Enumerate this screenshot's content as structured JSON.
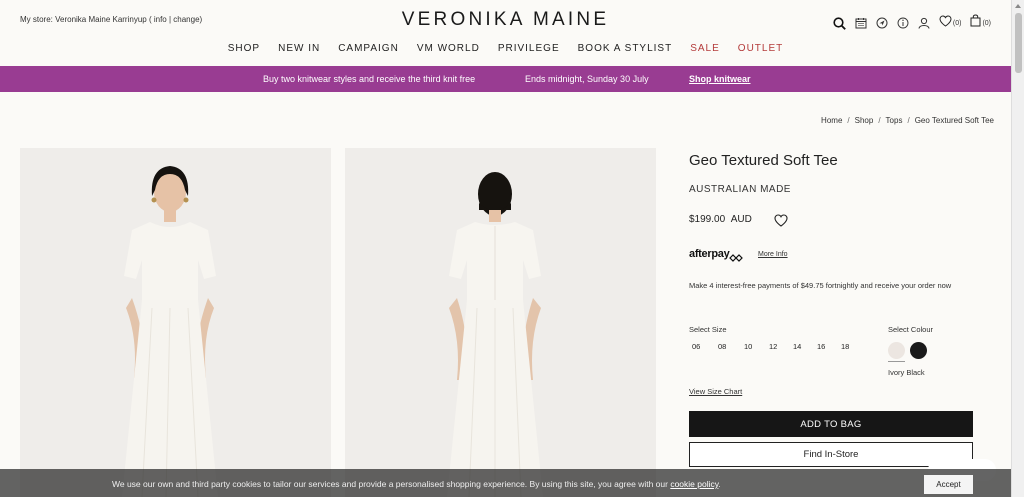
{
  "header": {
    "store_prefix": "My store: Veronika Maine Karrinyup ( ",
    "store_info": "info",
    "store_sep": " | ",
    "store_change": "change",
    "store_suffix": ")",
    "logo": "VERONIKA MAINE",
    "wishlist_count": "(0)",
    "bag_count": "(0)",
    "icons": [
      "search-icon",
      "calendar-icon",
      "location-icon",
      "info-icon",
      "account-icon",
      "heart-icon",
      "bag-icon"
    ]
  },
  "nav": {
    "items": [
      "SHOP",
      "NEW IN",
      "CAMPAIGN",
      "VM WORLD",
      "PRIVILEGE",
      "BOOK A STYLIST",
      "SALE",
      "OUTLET"
    ]
  },
  "promo": {
    "background": "#993c92",
    "text1": "Buy two knitwear styles and receive the third knit free",
    "text2": "Ends midnight, Sunday 30 July",
    "link": "Shop knitwear"
  },
  "breadcrumb": {
    "items": [
      "Home",
      "Shop",
      "Tops",
      "Geo Textured Soft Tee"
    ],
    "separator": "/"
  },
  "product": {
    "title": "Geo Textured Soft Tee",
    "origin": "AUSTRALIAN MADE",
    "price": "$199.00",
    "currency": "AUD",
    "afterpay_logo": "afterpay",
    "more_info": "More Info",
    "instalment": "Make 4 interest-free payments of $49.75 fortnightly and receive your order now",
    "size_label": "Select Size",
    "sizes": [
      "06",
      "08",
      "10",
      "12",
      "14",
      "16",
      "18"
    ],
    "colour_label": "Select Colour",
    "colour_names": "Ivory Black",
    "colours": [
      "#ece6e1",
      "#1a1a1a"
    ],
    "size_chart": "View Size Chart",
    "add_to_bag": "ADD TO BAG",
    "find_in_store": "Find In-Store"
  },
  "cookie": {
    "text": "We use our own and third party cookies to tailor our services and provide a personalised shopping experience. By using this site, you agree with our ",
    "link": "cookie policy",
    "suffix": ".",
    "accept": "Accept"
  }
}
